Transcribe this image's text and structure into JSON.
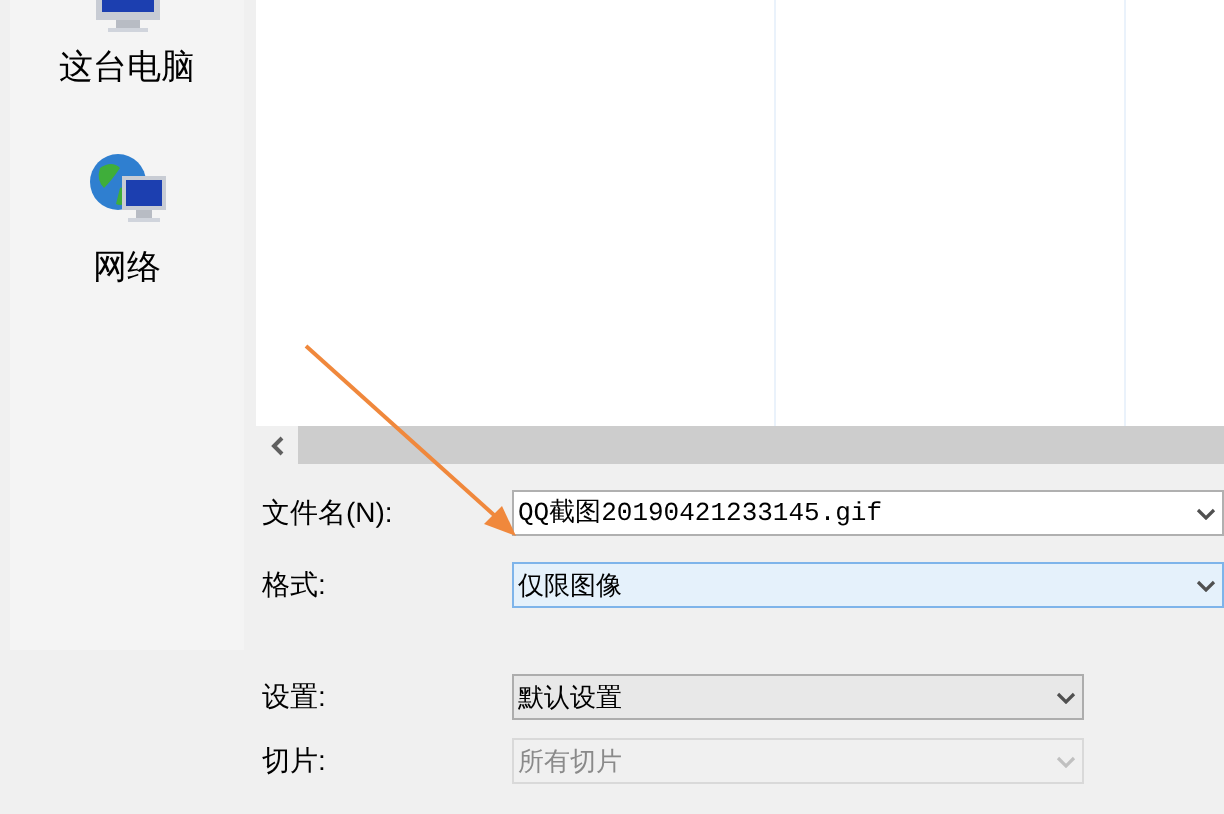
{
  "sidebar": {
    "items": [
      {
        "kind": "computer",
        "label": "这台电脑"
      },
      {
        "kind": "network",
        "label": "网络"
      }
    ]
  },
  "fields": [
    {
      "label": "文件名(N):",
      "value": "QQ截图20190421233145.gif",
      "wide": true,
      "focused": false,
      "disabled": false
    },
    {
      "label": "格式:",
      "value": "仅限图像",
      "wide": true,
      "focused": true,
      "disabled": false
    },
    {
      "label": "设置:",
      "value": "默认设置",
      "wide": false,
      "focused": false,
      "disabled": false
    },
    {
      "label": "切片:",
      "value": "所有切片",
      "wide": false,
      "focused": false,
      "disabled": true
    }
  ]
}
